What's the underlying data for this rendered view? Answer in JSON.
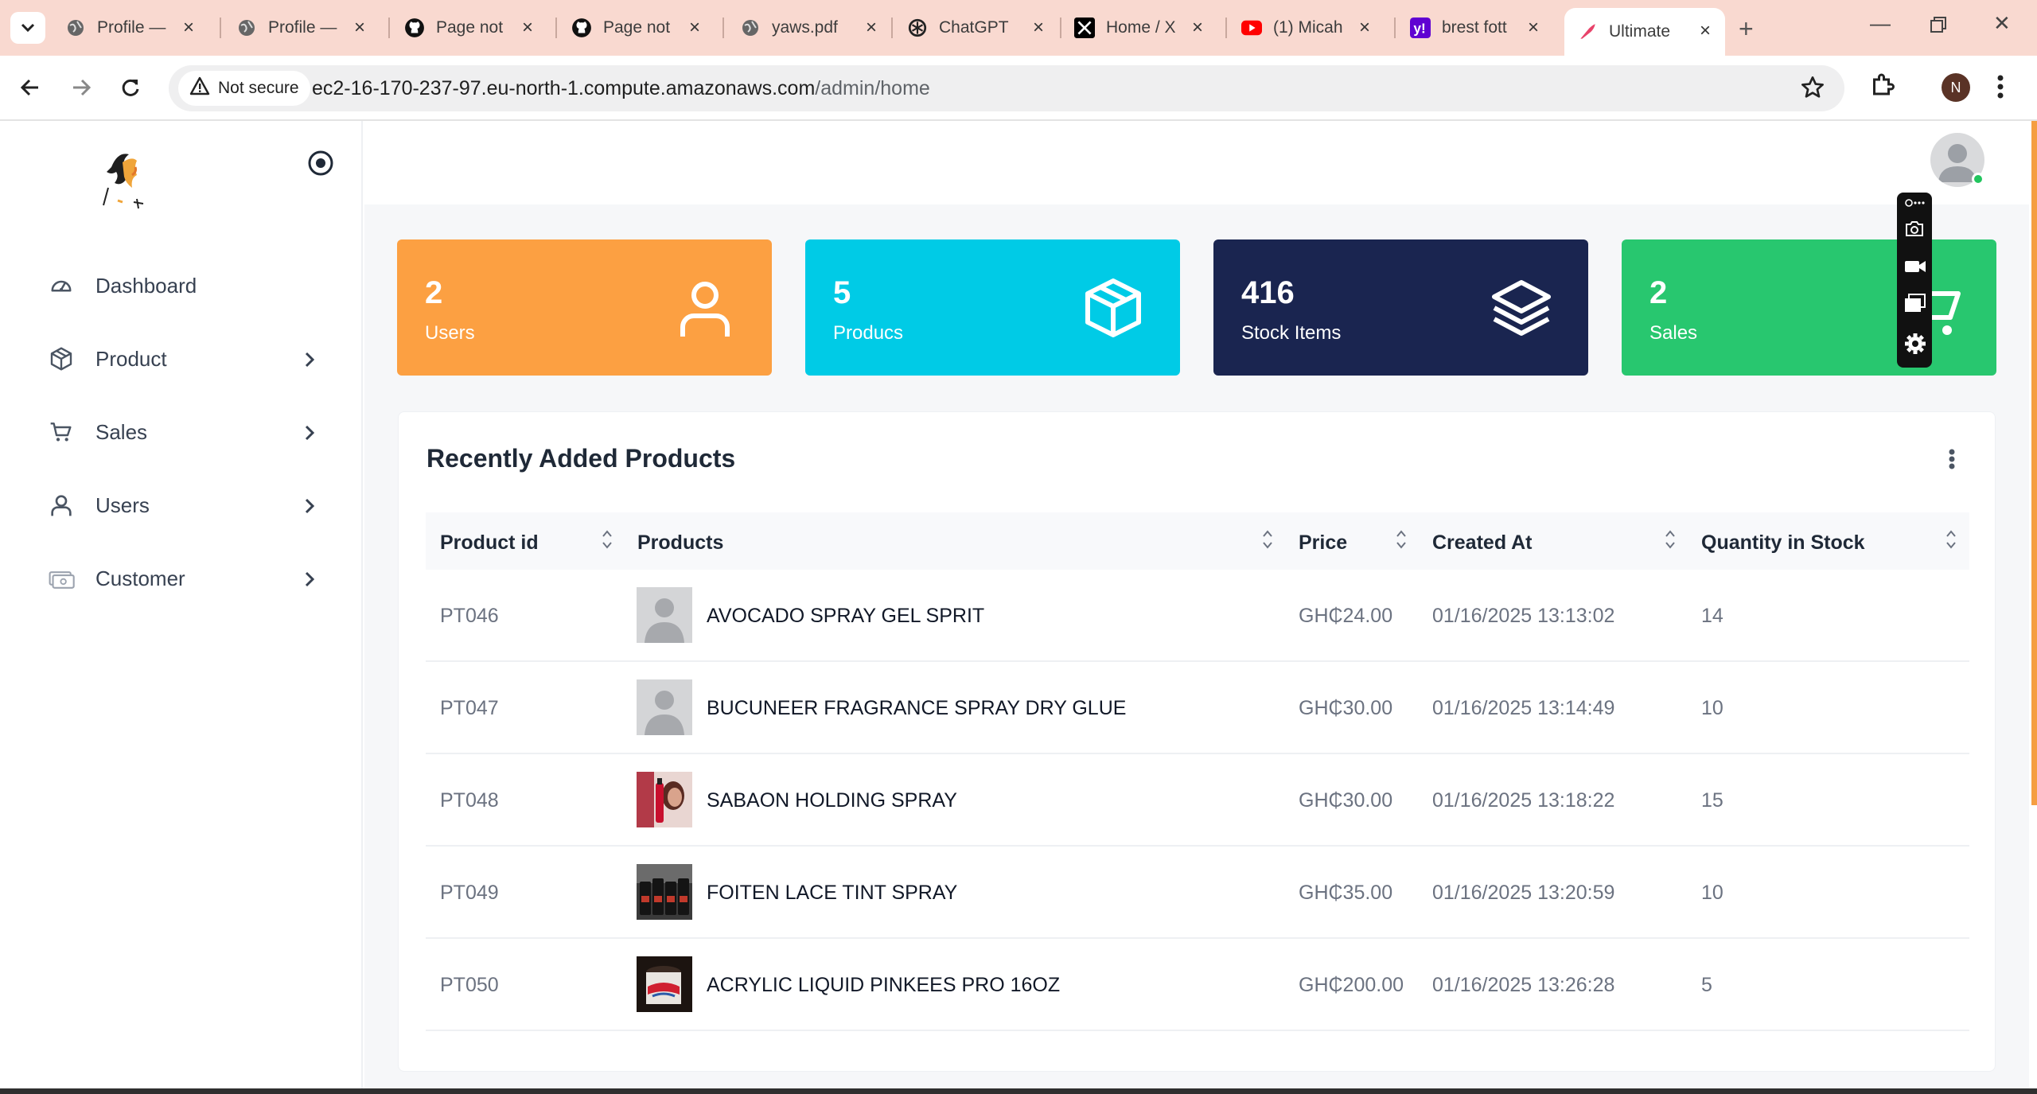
{
  "browser": {
    "tabs": [
      {
        "title": "Profile —",
        "icon": "globe-icon"
      },
      {
        "title": "Profile —",
        "icon": "globe-icon"
      },
      {
        "title": "Page not",
        "icon": "github-icon"
      },
      {
        "title": "Page not",
        "icon": "github-icon"
      },
      {
        "title": "yaws.pdf",
        "icon": "globe-icon"
      },
      {
        "title": "ChatGPT",
        "icon": "chatgpt-icon"
      },
      {
        "title": "Home / X",
        "icon": "x-icon"
      },
      {
        "title": "(1) Micah",
        "icon": "youtube-icon"
      },
      {
        "title": "brest fott",
        "icon": "yahoo-icon"
      },
      {
        "title": "Ultimate",
        "icon": "feather-icon"
      }
    ],
    "security_label": "Not secure",
    "url_host": "ec2-16-170-237-97.eu-north-1.compute.amazonaws.com",
    "url_path": "/admin/home",
    "profile_initial": "N"
  },
  "sidebar": {
    "items": [
      {
        "label": "Dashboard",
        "icon": "dashboard-icon",
        "has_submenu": false
      },
      {
        "label": "Product",
        "icon": "box-icon",
        "has_submenu": true
      },
      {
        "label": "Sales",
        "icon": "cart-icon",
        "has_submenu": true
      },
      {
        "label": "Users",
        "icon": "user-icon",
        "has_submenu": true
      },
      {
        "label": "Customer",
        "icon": "money-icon",
        "has_submenu": true
      }
    ]
  },
  "stats": [
    {
      "value": "2",
      "label": "Users",
      "color": "#fca042",
      "icon": "user-icon"
    },
    {
      "value": "5",
      "label": "Producs",
      "color": "#00cbe6",
      "icon": "box-icon"
    },
    {
      "value": "416",
      "label": "Stock Items",
      "color": "#1a2550",
      "icon": "layers-icon"
    },
    {
      "value": "2",
      "label": "Sales",
      "color": "#28c76f",
      "icon": "cart-icon"
    }
  ],
  "recent_products": {
    "title": "Recently Added Products",
    "columns": [
      "Product id",
      "Products",
      "Price",
      "Created At",
      "Quantity in Stock"
    ],
    "rows": [
      {
        "id": "PT046",
        "name": "AVOCADO SPRAY GEL SPRIT",
        "price": "GH₵24.00",
        "created": "01/16/2025 13:13:02",
        "qty": "14",
        "thumb": "placeholder"
      },
      {
        "id": "PT047",
        "name": "BUCUNEER FRAGRANCE SPRAY DRY GLUE",
        "price": "GH₵30.00",
        "created": "01/16/2025 13:14:49",
        "qty": "10",
        "thumb": "placeholder"
      },
      {
        "id": "PT048",
        "name": "SABAON HOLDING SPRAY",
        "price": "GH₵30.00",
        "created": "01/16/2025 13:18:22",
        "qty": "15",
        "thumb": "photo-red"
      },
      {
        "id": "PT049",
        "name": "FOITEN LACE TINT SPRAY",
        "price": "GH₵35.00",
        "created": "01/16/2025 13:20:59",
        "qty": "10",
        "thumb": "photo-bottles"
      },
      {
        "id": "PT050",
        "name": "ACRYLIC LIQUID PINKEES PRO 16OZ",
        "price": "GH₵200.00",
        "created": "01/16/2025 13:26:28",
        "qty": "5",
        "thumb": "photo-jar"
      }
    ]
  },
  "colors": {
    "orange": "#fca042",
    "cyan": "#00cbe6",
    "navy": "#1a2550",
    "green": "#28c76f"
  }
}
